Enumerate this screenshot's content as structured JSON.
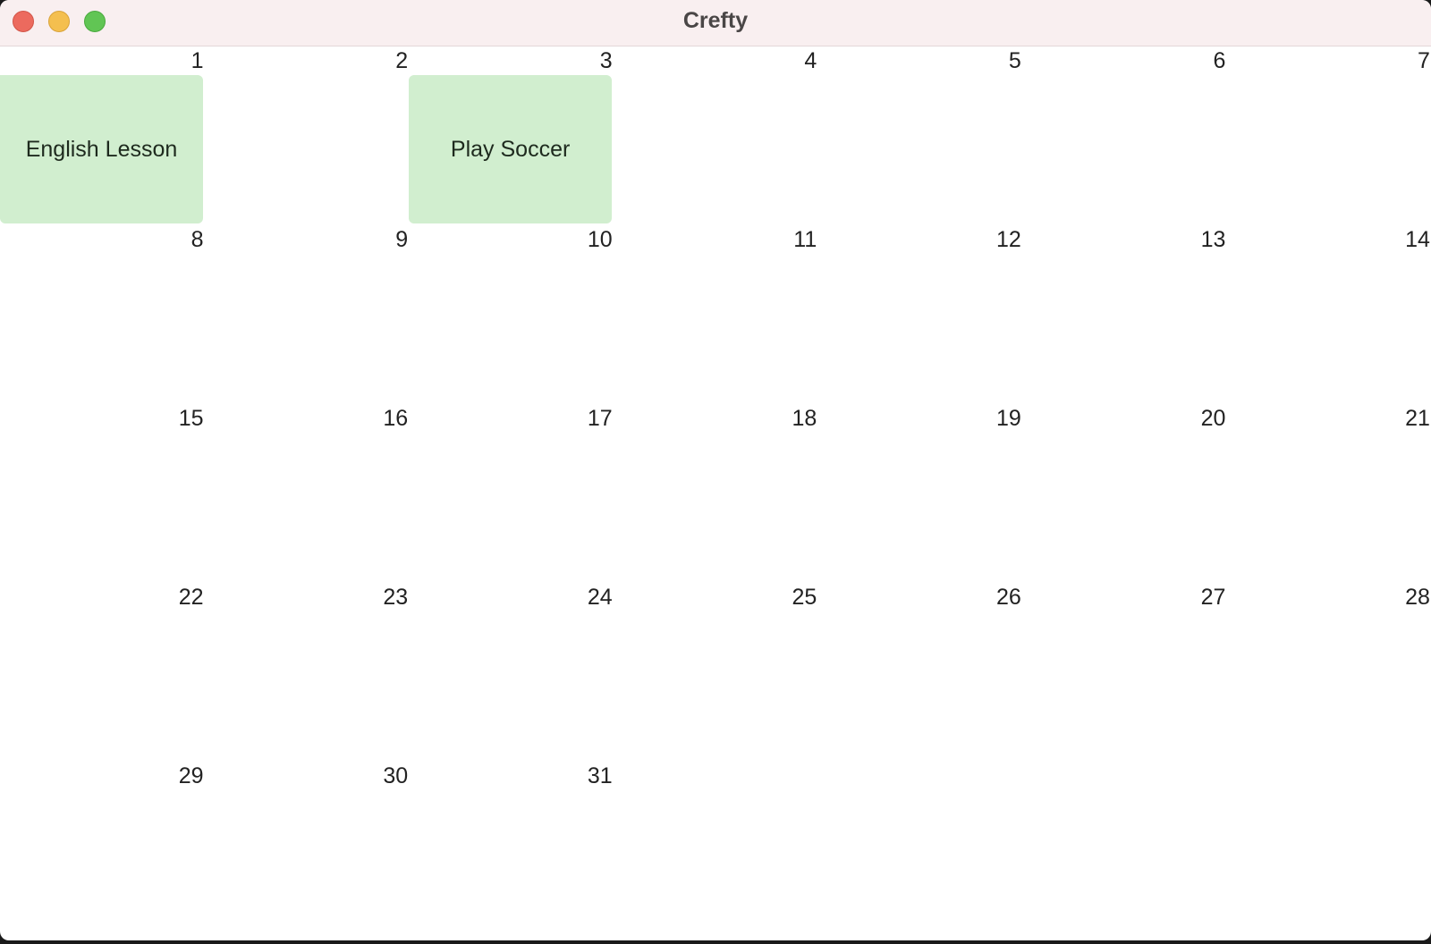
{
  "window": {
    "title": "Crefty"
  },
  "calendar": {
    "days": [
      "1",
      "2",
      "3",
      "4",
      "5",
      "6",
      "7",
      "8",
      "9",
      "10",
      "11",
      "12",
      "13",
      "14",
      "15",
      "16",
      "17",
      "18",
      "19",
      "20",
      "21",
      "22",
      "23",
      "24",
      "25",
      "26",
      "27",
      "28",
      "29",
      "30",
      "31"
    ],
    "events": [
      {
        "day": "1",
        "label": "English Lesson"
      },
      {
        "day": "3",
        "label": "Play Soccer"
      }
    ]
  },
  "colors": {
    "event_background": "#d1eecf",
    "titlebar_background": "#f9eff0"
  }
}
